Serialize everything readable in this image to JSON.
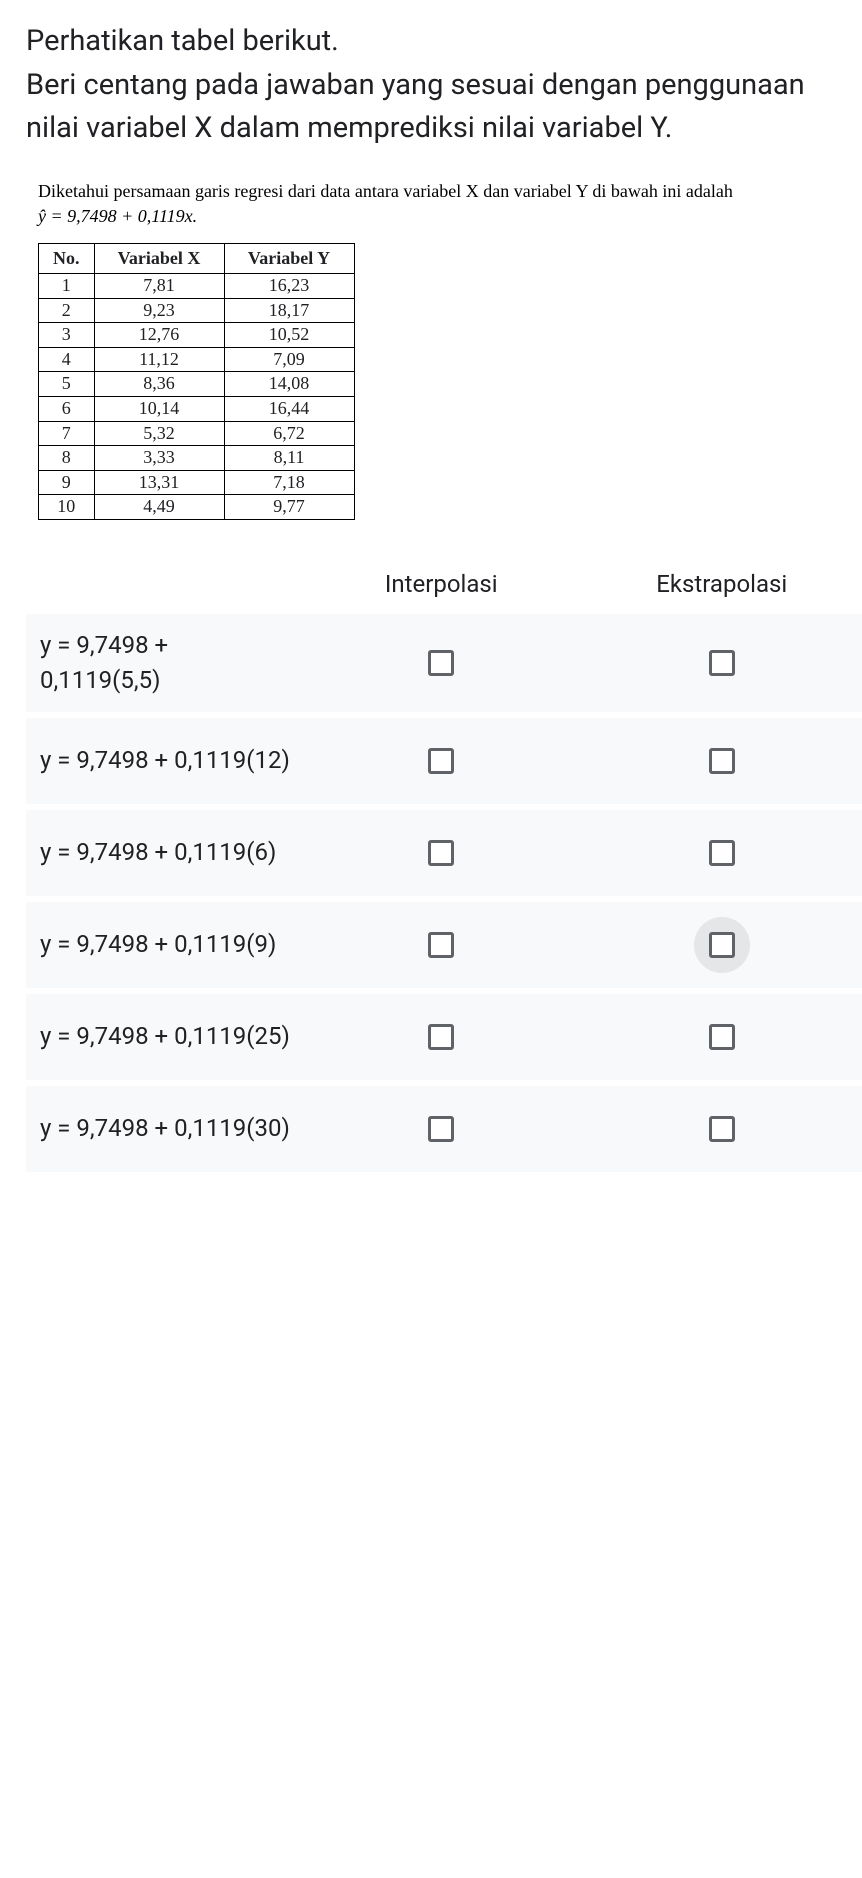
{
  "question": "Perhatikan tabel berikut.\nBeri centang pada jawaban yang sesuai dengan penggunaan nilai variabel X dalam memprediksi nilai variabel Y.",
  "regression": {
    "intro": "Diketahui persamaan garis regresi dari data antara variabel X dan variabel Y di bawah ini adalah",
    "equation": "ŷ = 9,7498 + 0,1119x."
  },
  "table": {
    "headers": {
      "no": "No.",
      "x": "Variabel X",
      "y": "Variabel Y"
    },
    "rows": [
      {
        "no": "1",
        "x": "7,81",
        "y": "16,23"
      },
      {
        "no": "2",
        "x": "9,23",
        "y": "18,17"
      },
      {
        "no": "3",
        "x": "12,76",
        "y": "10,52"
      },
      {
        "no": "4",
        "x": "11,12",
        "y": "7,09"
      },
      {
        "no": "5",
        "x": "8,36",
        "y": "14,08"
      },
      {
        "no": "6",
        "x": "10,14",
        "y": "16,44"
      },
      {
        "no": "7",
        "x": "5,32",
        "y": "6,72"
      },
      {
        "no": "8",
        "x": "3,33",
        "y": "8,11"
      },
      {
        "no": "9",
        "x": "13,31",
        "y": "7,18"
      },
      {
        "no": "10",
        "x": "4,49",
        "y": "9,77"
      }
    ]
  },
  "columns": {
    "interpolasi": "Interpolasi",
    "ekstrapolasi": "Ekstrapolasi"
  },
  "answer_rows": [
    {
      "label": "y = 9,7498 + 0,1119(5,5)",
      "hover_ekstra": false
    },
    {
      "label": "y = 9,7498 + 0,1119(12)",
      "hover_ekstra": false
    },
    {
      "label": "y = 9,7498 + 0,1119(6)",
      "hover_ekstra": false
    },
    {
      "label": "y = 9,7498 + 0,1119(9)",
      "hover_ekstra": true
    },
    {
      "label": "y = 9,7498 + 0,1119(25)",
      "hover_ekstra": false
    },
    {
      "label": "y = 9,7498 + 0,1119(30)",
      "hover_ekstra": false
    }
  ]
}
